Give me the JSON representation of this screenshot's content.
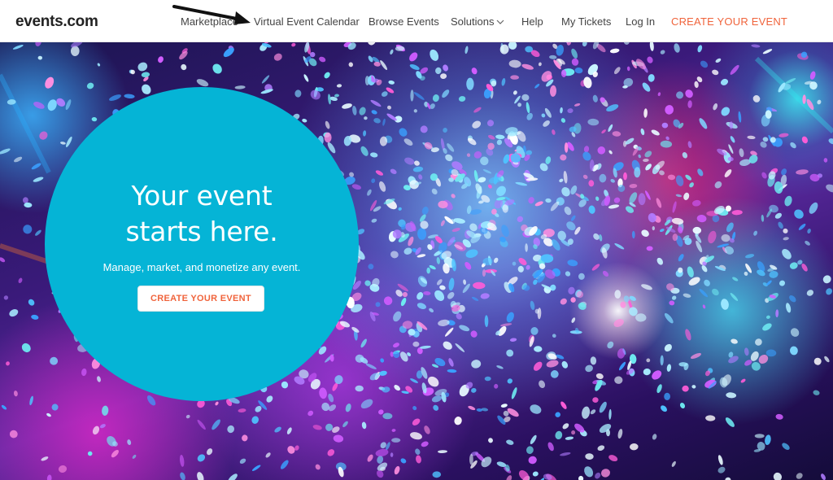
{
  "header": {
    "logo": "events.com",
    "nav": [
      {
        "label": "Marketplace"
      },
      {
        "label": "Virtual Event Calendar"
      },
      {
        "label": "Browse Events"
      },
      {
        "label": "Solutions"
      },
      {
        "label": "Help"
      },
      {
        "label": "My Tickets"
      },
      {
        "label": "Log In"
      },
      {
        "label": "CREATE YOUR EVENT"
      }
    ]
  },
  "hero": {
    "headline_line1": "Your event",
    "headline_line2": "starts here.",
    "subtitle": "Manage, market, and monetize any event.",
    "cta_label": "CREATE YOUR EVENT"
  },
  "colors": {
    "accent": "#f0643c",
    "circle": "#05b4d6",
    "nav_text": "#444444"
  },
  "icons": {
    "annotation": "arrow-icon",
    "dropdown": "chevron-down-icon"
  }
}
